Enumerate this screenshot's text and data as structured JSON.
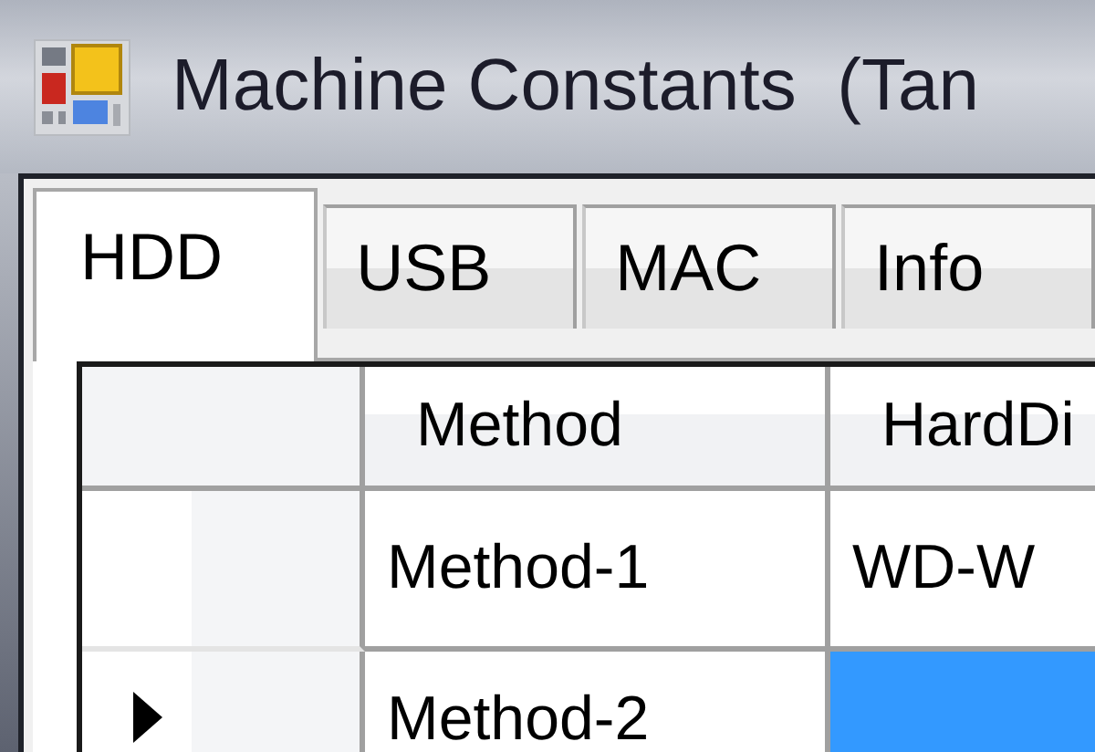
{
  "window": {
    "title": "Machine Constants  (Tan"
  },
  "tabs": [
    {
      "label": "HDD",
      "selected": true
    },
    {
      "label": "USB",
      "selected": false
    },
    {
      "label": "MAC",
      "selected": false
    },
    {
      "label": "Info",
      "selected": false
    }
  ],
  "grid": {
    "columns": [
      "Method",
      "HardDi"
    ],
    "rows": [
      {
        "current": false,
        "cells": [
          {
            "text": "Method-1",
            "selected": false
          },
          {
            "text": "WD-W",
            "selected": false
          }
        ]
      },
      {
        "current": true,
        "cells": [
          {
            "text": "Method-2",
            "selected": false
          },
          {
            "selected": true
          }
        ]
      }
    ]
  }
}
